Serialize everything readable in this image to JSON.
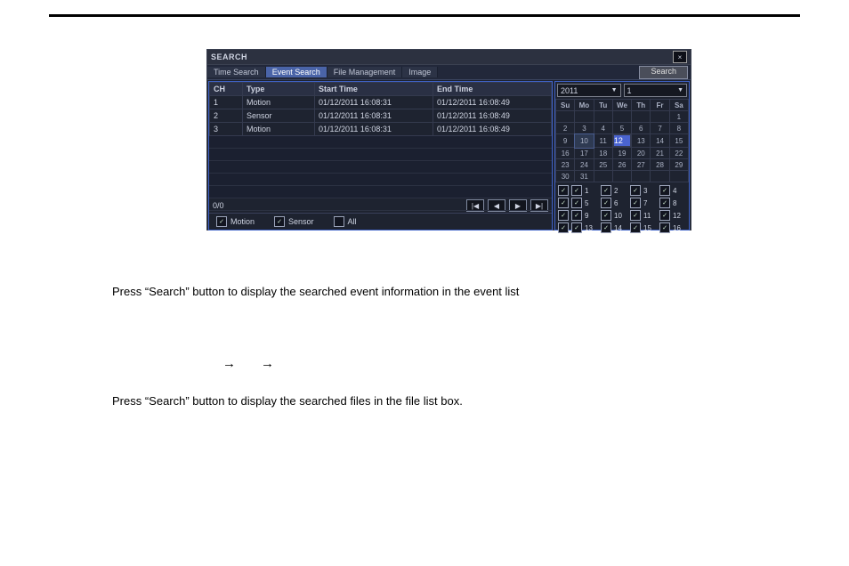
{
  "window": {
    "title": "SEARCH",
    "close_label": "×",
    "tabs": [
      "Time Search",
      "Event Search",
      "File Management",
      "Image"
    ],
    "active_tab_index": 1,
    "search_button_label": "Search"
  },
  "event_table": {
    "headers": [
      "CH",
      "Type",
      "Start Time",
      "End Time"
    ],
    "rows": [
      {
        "ch": "1",
        "type": "Motion",
        "start": "01/12/2011 16:08:31",
        "end": "01/12/2011 16:08:49"
      },
      {
        "ch": "2",
        "type": "Sensor",
        "start": "01/12/2011 16:08:31",
        "end": "01/12/2011 16:08:49"
      },
      {
        "ch": "3",
        "type": "Motion",
        "start": "01/12/2011 16:08:31",
        "end": "01/12/2011 16:08:49"
      }
    ],
    "page_indicator": "0/0",
    "play_controls": {
      "first": "|◀",
      "prev": "◀",
      "next": "▶",
      "last": "▶|"
    }
  },
  "filters": {
    "motion": {
      "label": "Motion",
      "checked": true
    },
    "sensor": {
      "label": "Sensor",
      "checked": true
    },
    "all": {
      "label": "All",
      "checked": false
    }
  },
  "calendar": {
    "year": "2011",
    "month": "1",
    "dow": [
      "Su",
      "Mo",
      "Tu",
      "We",
      "Th",
      "Fr",
      "Sa"
    ],
    "weeks": [
      [
        "",
        "",
        "",
        "",
        "",
        "",
        "1"
      ],
      [
        "2",
        "3",
        "4",
        "5",
        "6",
        "7",
        "8"
      ],
      [
        "9",
        "10",
        "11",
        "12",
        "13",
        "14",
        "15"
      ],
      [
        "16",
        "17",
        "18",
        "19",
        "20",
        "21",
        "22"
      ],
      [
        "23",
        "24",
        "25",
        "26",
        "27",
        "28",
        "29"
      ],
      [
        "30",
        "31",
        "",
        "",
        "",
        "",
        ""
      ]
    ],
    "highlight_days": [
      "10"
    ],
    "selected_day": "12"
  },
  "channels": {
    "master_checked": true,
    "items": [
      {
        "n": "1",
        "c": true
      },
      {
        "n": "2",
        "c": true
      },
      {
        "n": "3",
        "c": true
      },
      {
        "n": "4",
        "c": true
      },
      {
        "n": "5",
        "c": true
      },
      {
        "n": "6",
        "c": true
      },
      {
        "n": "7",
        "c": true
      },
      {
        "n": "8",
        "c": true
      },
      {
        "n": "9",
        "c": true
      },
      {
        "n": "10",
        "c": true
      },
      {
        "n": "11",
        "c": true
      },
      {
        "n": "12",
        "c": true
      },
      {
        "n": "13",
        "c": true
      },
      {
        "n": "14",
        "c": true
      },
      {
        "n": "15",
        "c": true
      },
      {
        "n": "16",
        "c": true
      }
    ]
  },
  "doc": {
    "p1": "Press “Search” button to display the searched event information in the event list",
    "arrows": "→→",
    "p2": "Press “Search” button to display the searched files in the file list box."
  }
}
